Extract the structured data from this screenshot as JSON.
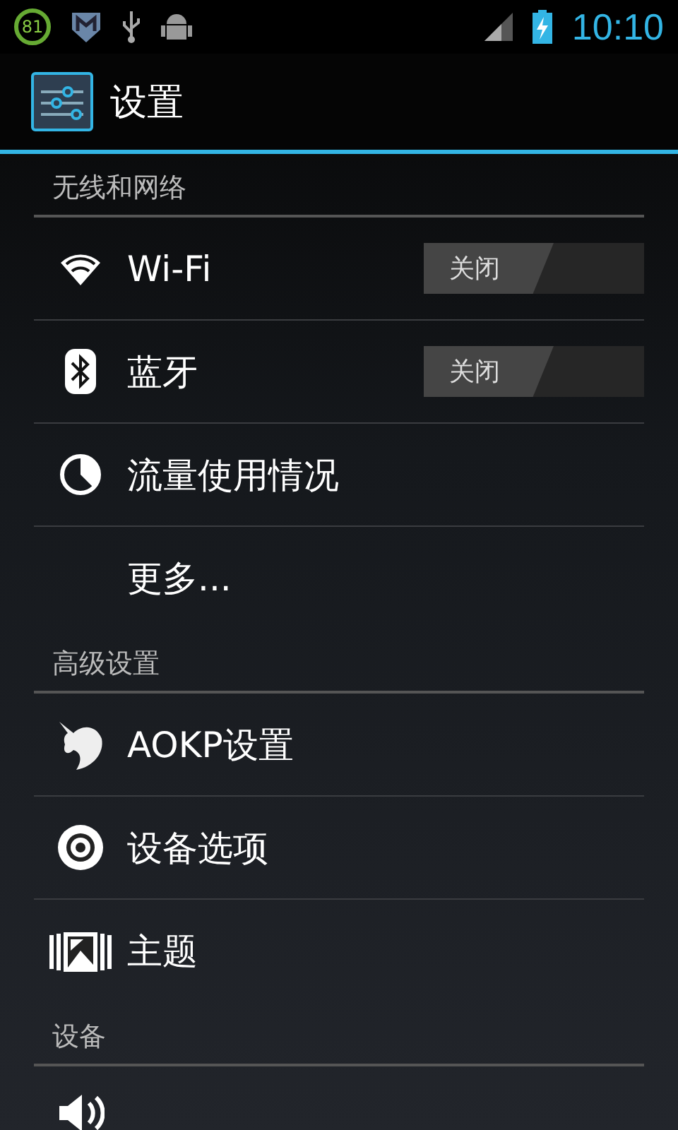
{
  "status_bar": {
    "badge": "81",
    "time": "10:10"
  },
  "action_bar": {
    "title": "设置"
  },
  "sections": [
    {
      "header": "无线和网络",
      "items": [
        {
          "kind": "wifi",
          "label": "Wi-Fi",
          "switch": {
            "label": "关闭",
            "on": false
          }
        },
        {
          "kind": "bluetooth",
          "label": "蓝牙",
          "switch": {
            "label": "关闭",
            "on": false
          }
        },
        {
          "kind": "data-usage",
          "label": "流量使用情况"
        },
        {
          "kind": "more",
          "label": "更多..."
        }
      ]
    },
    {
      "header": "高级设置",
      "items": [
        {
          "kind": "aokp",
          "label": "AOKP设置"
        },
        {
          "kind": "device-options",
          "label": "设备选项"
        },
        {
          "kind": "theme",
          "label": "主题"
        }
      ]
    },
    {
      "header": "设备",
      "items": [
        {
          "kind": "sound"
        }
      ]
    }
  ]
}
